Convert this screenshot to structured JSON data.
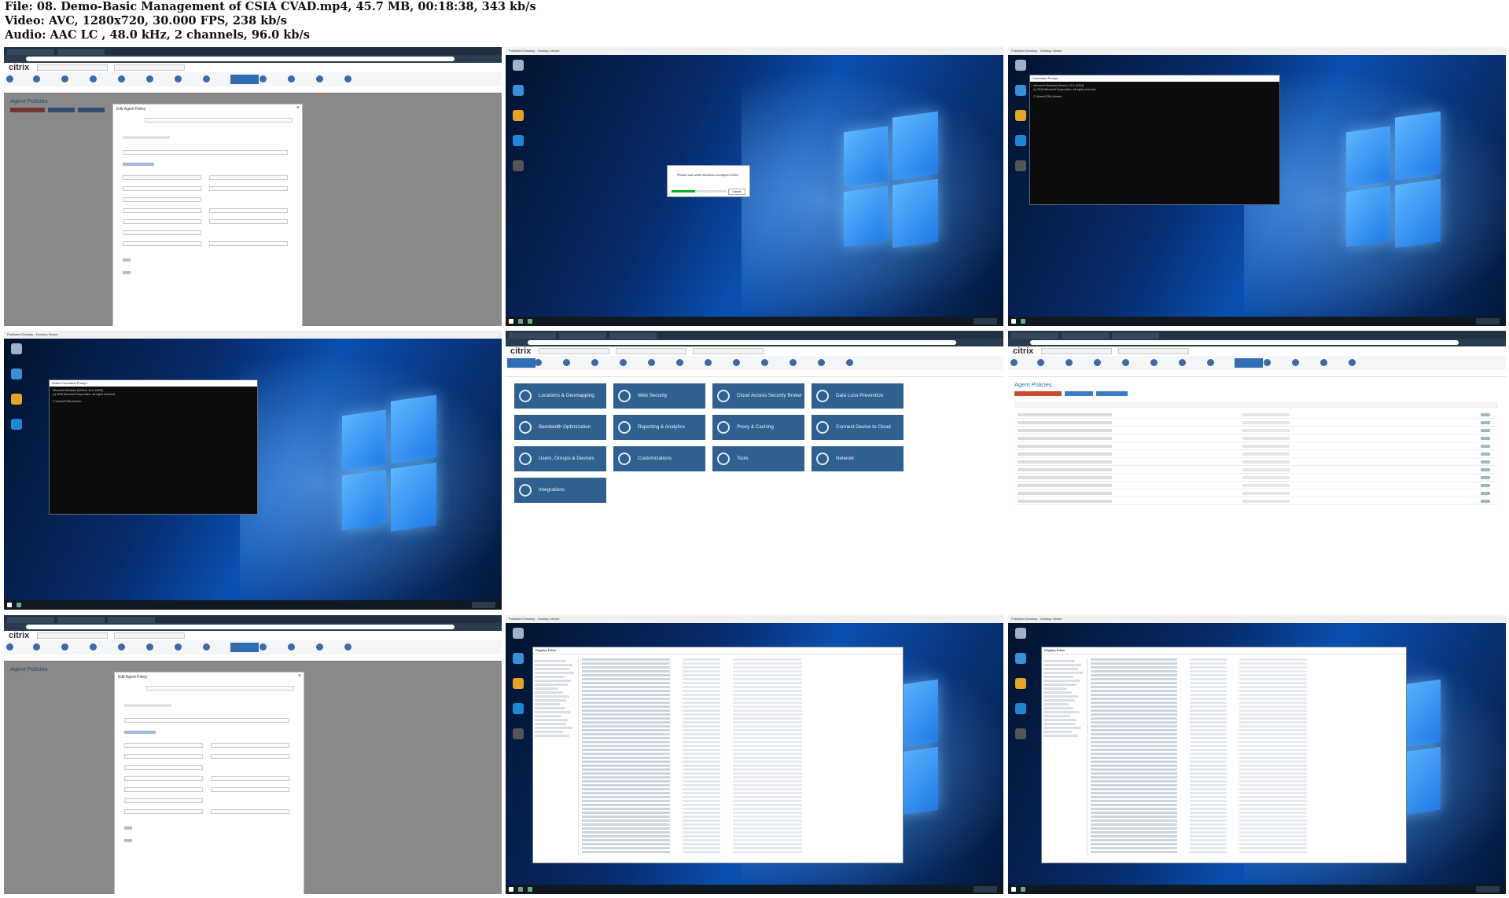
{
  "header": {
    "file_line": "File: 08. Demo-Basic Management of CSIA  CVAD.mp4, 45.7 MB, 00:18:38, 343 kb/s",
    "video_line": "Video: AVC, 1280x720, 30.000 FPS, 238 kb/s",
    "audio_line": "Audio: AAC LC , 48.0 kHz, 2 channels, 96.0 kb/s"
  },
  "citrix_brand": "citrix",
  "agent_policies": {
    "page_title": "Agent Policies",
    "dialog_title": "Edit Agent Policy",
    "close_glyph": "×"
  },
  "desktop_title": "Published Desktop - Desktop Viewer",
  "progress_dialog": {
    "message": "Please wait while Windows configures WSA",
    "cancel_label": "Cancel"
  },
  "cmd": {
    "title": "Command Prompt",
    "title_select": "Select Command Prompt",
    "line1": "Microsoft Windows [Version 10.0.14393]",
    "line2": "(c) 2016 Microsoft Corporation. All rights reserved.",
    "line3": "C:\\Users\\CSIA-Admin>"
  },
  "regedit_title": "Registry Editor",
  "tiles": [
    {
      "label": "Locations & Geomapping",
      "icon": "cloud-pin-icon"
    },
    {
      "label": "Web Security",
      "icon": "globe-shield-icon"
    },
    {
      "label": "Cloud Access Security Broker",
      "icon": "casb-icon"
    },
    {
      "label": "Data Loss Prevention",
      "icon": "lock-doc-icon"
    },
    {
      "label": "Bandwidth Optimization",
      "icon": "gauge-icon"
    },
    {
      "label": "Reporting & Analytics",
      "icon": "bar-chart-icon"
    },
    {
      "label": "Proxy & Caching",
      "icon": "proxy-globe-icon"
    },
    {
      "label": "Connect Device to Cloud",
      "icon": "connect-icon"
    },
    {
      "label": "Users, Groups & Devices",
      "icon": "users-icon"
    },
    {
      "label": "Customizations",
      "icon": "gears-icon"
    },
    {
      "label": "Tools",
      "icon": "wrench-icon"
    },
    {
      "label": "Network",
      "icon": "network-icon"
    },
    {
      "label": "Integrations",
      "icon": "plug-icon"
    }
  ],
  "colors": {
    "tile_blue": "#2f6090",
    "accent_blue": "#2f6db5",
    "action_red": "#c94a32"
  }
}
